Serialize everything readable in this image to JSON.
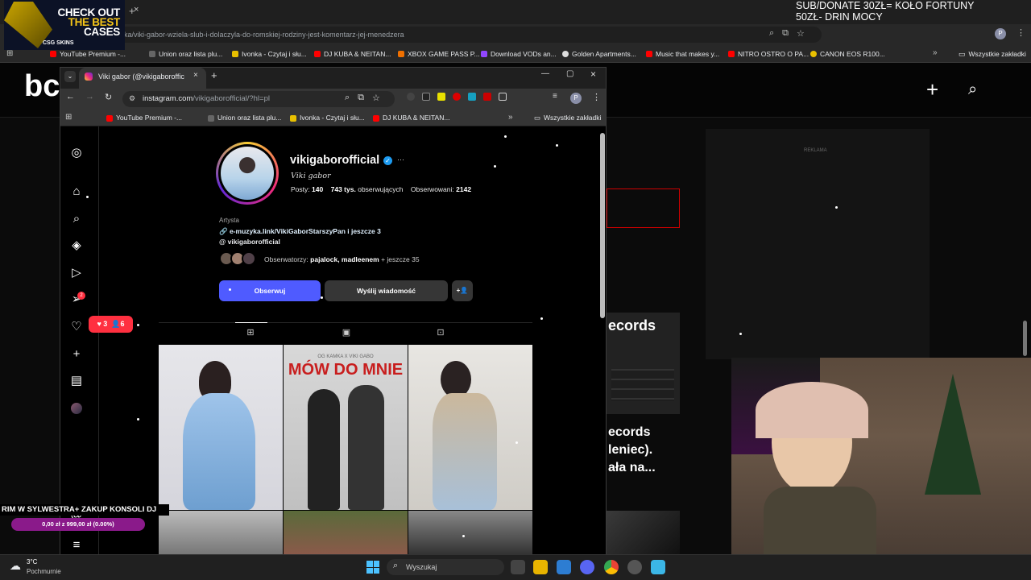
{
  "outer_browser": {
    "new_tab_label": "+",
    "address": "rywka/viki-gabor-wziela-slub-i-dolaczyla-do-romskiej-rodziny-jest-komentarz-jej-menedzera",
    "bookmarks": [
      "YouTube Premium -...",
      "Union oraz lista plu...",
      "Ivonka - Czytaj i słu...",
      "DJ KUBA & NEITAN...",
      "XBOX GAME PASS P...",
      "Download VODs an...",
      "Golden Apartments...",
      "Music that makes y...",
      "NITRO OSTRO O PA...",
      "CANON EOS R100..."
    ],
    "all_bookmarks": "Wszystkie zakładki"
  },
  "promo": {
    "line1": "CHECK OUT",
    "line2": "THE BEST",
    "line3": "CASES",
    "brand": "CSG SKINS"
  },
  "donate": {
    "line1": "SUB/DONATE 30ZŁ= KOŁO FORTUNY",
    "line2": "50ZŁ- DRIN MOCY"
  },
  "background_page": {
    "logo": "bc",
    "ad_label": "REKLAMA",
    "records_1": "ecords",
    "article_l1": "ecords",
    "article_l2": "leniec).",
    "article_l3": "ała na..."
  },
  "inner_browser": {
    "tab_title": "Viki gabor (@vikigaboroffic",
    "new_tab": "+",
    "url_prefix": "instagram.com",
    "url_rest": "/vikigaborofficial/?hl=pl",
    "bookmarks": [
      "YouTube Premium -...",
      "Union oraz lista plu...",
      "Ivonka - Czytaj i słu...",
      "DJ KUBA & NEITAN..."
    ],
    "all_bookmarks": "Wszystkie zakładki"
  },
  "profile": {
    "username": "vikigaborofficial",
    "verified_mark": "✓",
    "more": "···",
    "full_name": "Viki gabor",
    "posts_label": "Posty:",
    "posts": "140",
    "followers": "743 tys.",
    "followers_label": "obserwujących",
    "following_label": "Obserwowani:",
    "following": "2142",
    "category": "Artysta",
    "link": "e-muzyka.link/VikiGaborStarszyPan i jeszcze 3",
    "threads": "vikigaborofficial",
    "followed_by_label": "Obserwatorzy:",
    "followed_by_names": "pajalock, madleenem",
    "followed_by_more": "+ jeszcze 35",
    "follow_button": "Obserwuj",
    "message_button": "Wyślij wiadomość",
    "add_person": "+👤"
  },
  "notifications": {
    "likes": "3",
    "follows": "6",
    "dm_badge": "2"
  },
  "posts": [
    {
      "caption": ""
    },
    {
      "caption": "MÓW DO MNIE",
      "overlay": "OG KAMKA X VIKI GABO"
    },
    {
      "caption": ""
    }
  ],
  "stream_goal": {
    "title": "RIM W SYLWESTRA+ ZAKUP KONSOLI DJ",
    "progress_text": "0,00 zł z 999,00 zł (0.00%)",
    "progress": 0
  },
  "weather": {
    "temp": "3°C",
    "condition": "Pochmurnie"
  },
  "taskbar": {
    "search_placeholder": "Wyszukaj"
  }
}
